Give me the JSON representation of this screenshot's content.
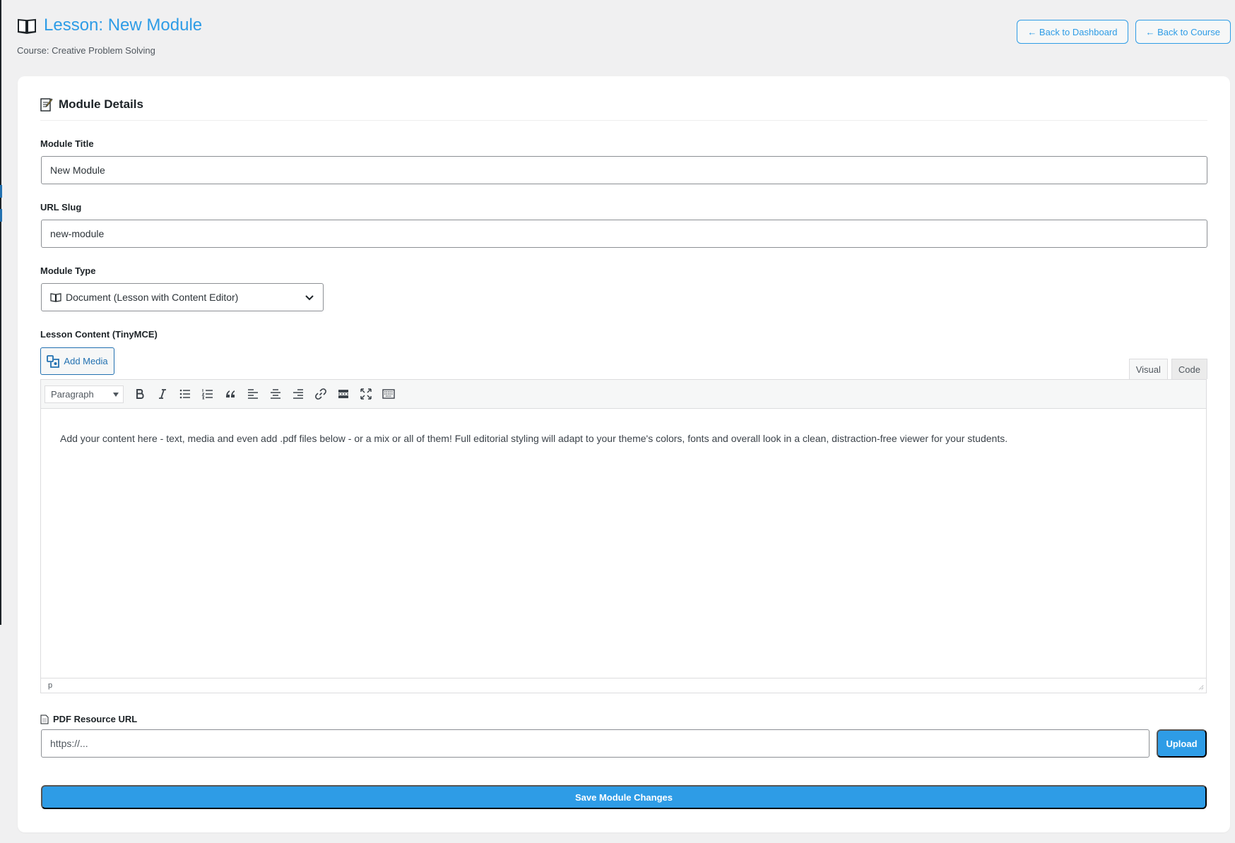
{
  "header": {
    "title": "Lesson: New Module",
    "course_line": "Course: Creative Problem Solving",
    "back_dashboard": "← Back to Dashboard",
    "back_course": "← Back to Course",
    "title_icon": "open-book-icon",
    "accent_color": "#2e9ce6"
  },
  "section": {
    "title": "Module Details",
    "icon": "memo-icon"
  },
  "fields": {
    "module_title_label": "Module Title",
    "module_title_value": "New Module",
    "slug_label": "URL Slug",
    "slug_value": "new-module",
    "type_label": "Module Type",
    "type_value": "Document (Lesson with Content Editor)",
    "content_label": "Lesson Content (TinyMCE)"
  },
  "editor": {
    "add_media": "Add Media",
    "tab_visual": "Visual",
    "tab_code": "Code",
    "format_value": "Paragraph",
    "toolbar": [
      "bold-icon",
      "italic-icon",
      "bullet-list-icon",
      "numbered-list-icon",
      "blockquote-icon",
      "align-left-icon",
      "align-center-icon",
      "align-right-icon",
      "link-icon",
      "read-more-icon",
      "fullscreen-icon",
      "toolbar-toggle-icon"
    ],
    "content": "Add your content here - text, media and even add .pdf files below - or a mix or all of them! Full editorial styling will adapt to your theme's colors, fonts and overall look in a clean, distraction-free viewer for your students.",
    "status_path": "p"
  },
  "pdf": {
    "label": "PDF Resource URL",
    "placeholder": "https://...",
    "upload": "Upload"
  },
  "save_label": "Save Module Changes"
}
